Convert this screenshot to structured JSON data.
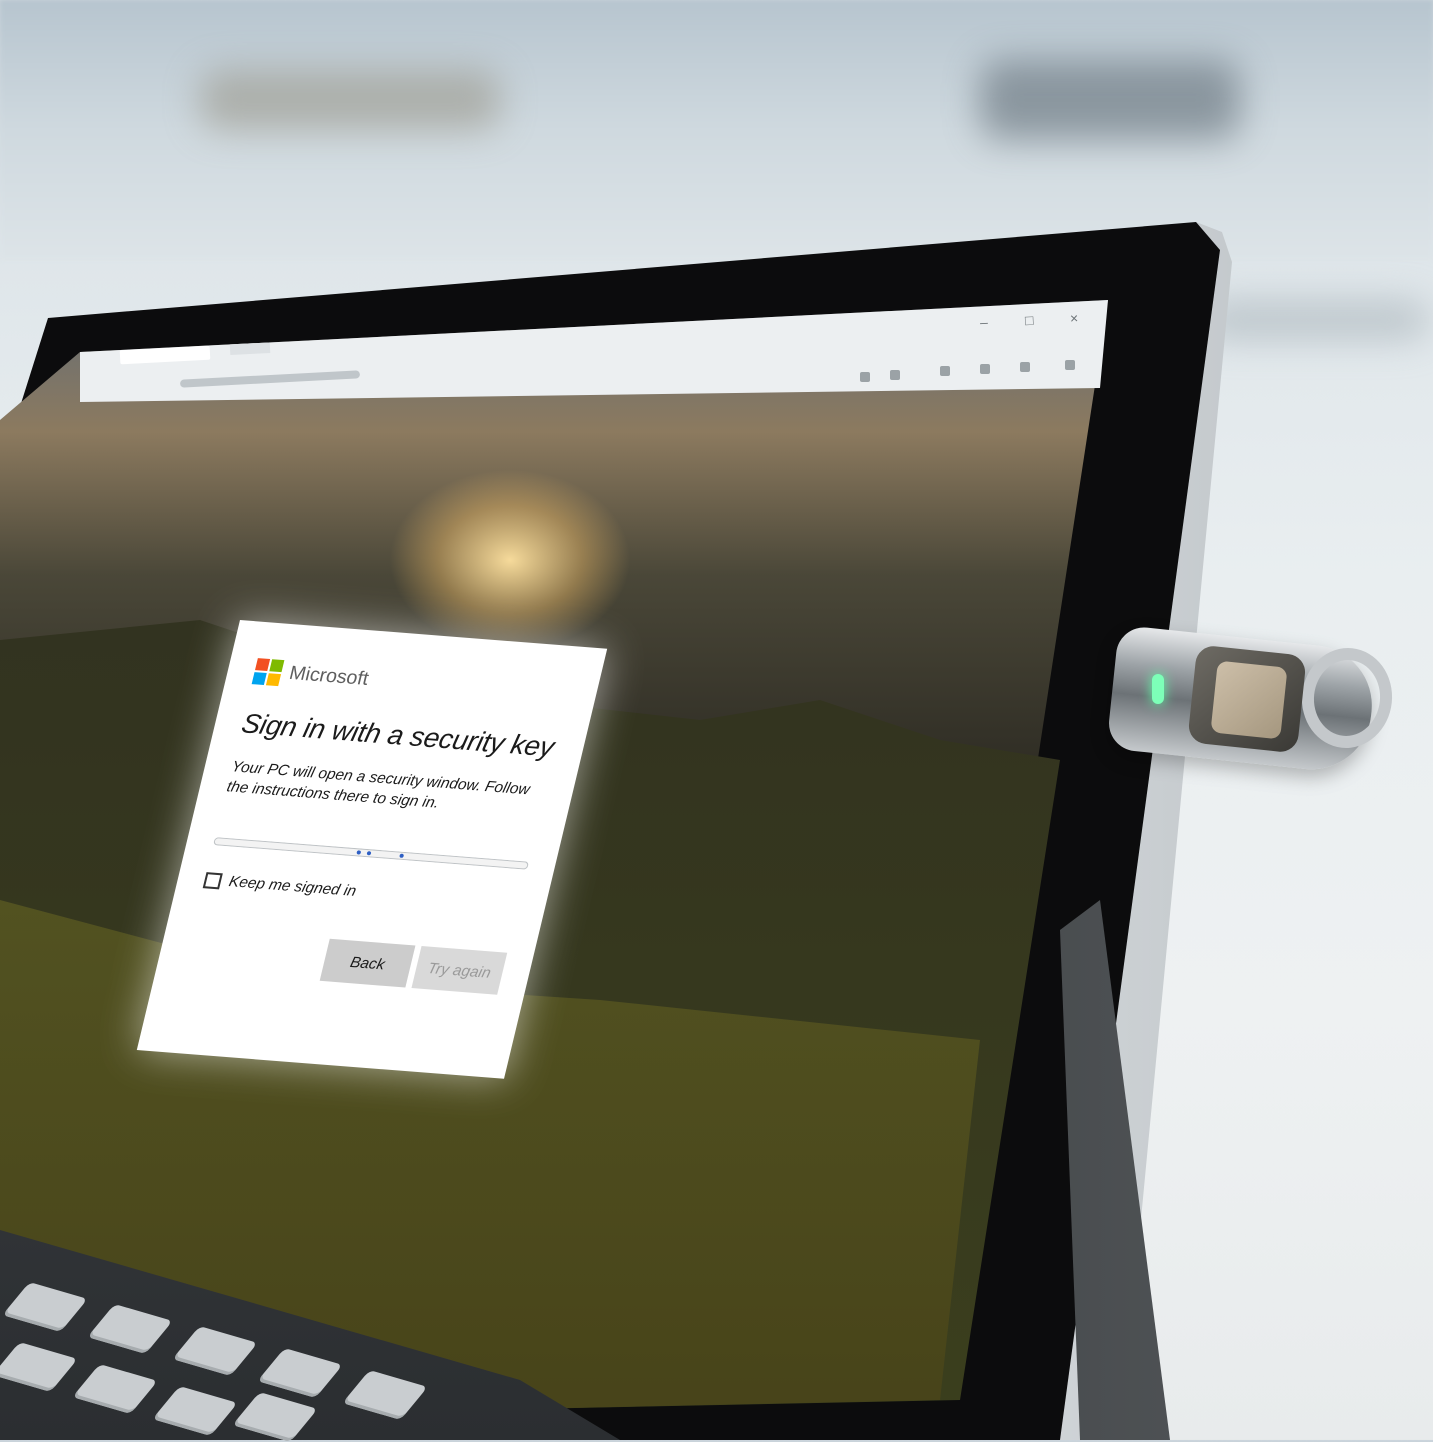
{
  "dialog": {
    "brand": "Microsoft",
    "title": "Sign in with a security key",
    "description": "Your PC will open a security window. Follow the instructions there to sign in.",
    "keep_signed_in_label": "Keep me signed in",
    "keep_signed_in_checked": false,
    "back_label": "Back",
    "try_again_label": "Try again",
    "try_again_enabled": false
  },
  "browser": {
    "window_controls": [
      "–",
      "□",
      "×"
    ]
  },
  "colors": {
    "ms_red": "#f25022",
    "ms_green": "#7fba00",
    "ms_blue": "#00a4ef",
    "ms_yellow": "#ffb900",
    "progress_dot": "#2e5fc4",
    "usb_led": "#7dffb8"
  },
  "icons": [
    "microsoft-logo-icon",
    "checkbox-icon",
    "fingerprint-sensor-icon",
    "status-led-icon"
  ]
}
